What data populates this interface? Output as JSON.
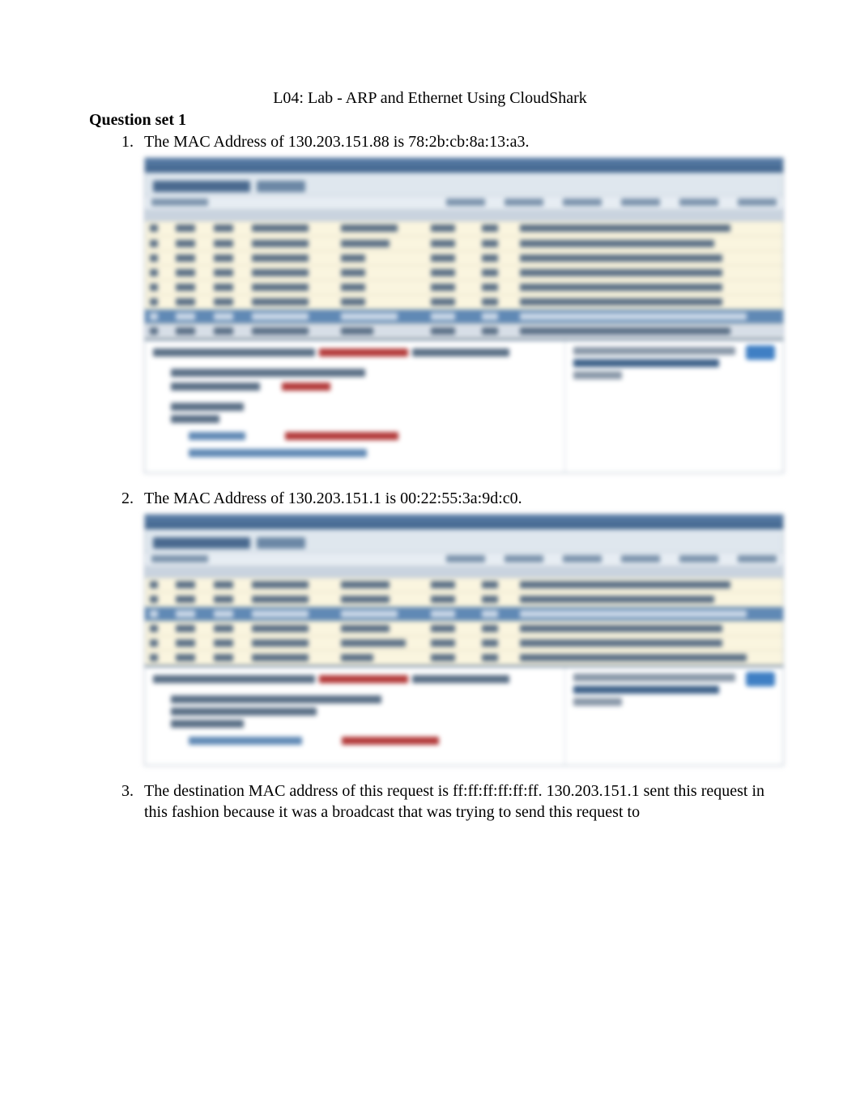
{
  "title": "L04: Lab - ARP and Ethernet Using CloudShark",
  "section_heading": "Question set 1",
  "items": {
    "1": "The MAC Address of 130.203.151.88 is 78:2b:cb:8a:13:a3.",
    "2": "The MAC Address of 130.203.151.1 is 00:22:55:3a:9d:c0.",
    "3": "The destination MAC address of this request is ff:ff:ff:ff:ff:ff. 130.203.151.1 sent this request in this fashion because it was a broadcast that was trying to send this request to"
  }
}
